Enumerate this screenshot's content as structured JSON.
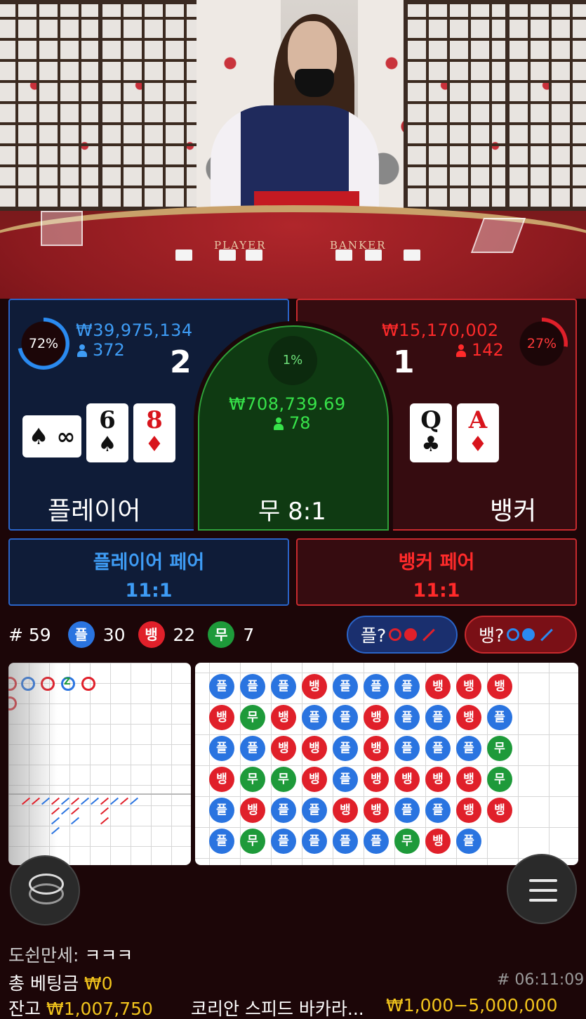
{
  "player": {
    "percent": "72%",
    "percent_value": 0.72,
    "amount": "₩39,975,134",
    "count": "372",
    "score": "2",
    "cards": [
      {
        "rank": "6",
        "suit": "♠",
        "color": "black"
      },
      {
        "rank": "8",
        "suit": "♦",
        "color": "red"
      }
    ],
    "hidden_card": "♠ ∞",
    "label": "플레이어"
  },
  "banker": {
    "percent": "27%",
    "percent_value": 0.27,
    "amount": "₩15,170,002",
    "count": "142",
    "score": "1",
    "cards": [
      {
        "rank": "Q",
        "suit": "♣",
        "color": "black"
      },
      {
        "rank": "A",
        "suit": "♦",
        "color": "red"
      }
    ],
    "label": "뱅커"
  },
  "tie": {
    "percent": "1%",
    "amount": "₩708,739.69",
    "count": "78",
    "label": "무 8:1"
  },
  "pairs": {
    "player": {
      "label": "플레이어 페어",
      "odds": "11:1"
    },
    "banker": {
      "label": "뱅커 페어",
      "odds": "11:1"
    }
  },
  "stats": {
    "round": "# 59",
    "player_short": "플",
    "player_count": "30",
    "banker_short": "뱅",
    "banker_count": "22",
    "tie_short": "무",
    "tie_count": "7"
  },
  "predict": {
    "player_label": "플?",
    "banker_label": "뱅?"
  },
  "table_text": {
    "player": "PLAYER",
    "banker": "BANKER"
  },
  "bead_road": [
    [
      "플",
      "뱅",
      "플",
      "뱅",
      "플",
      "플"
    ],
    [
      "플",
      "무",
      "플",
      "무",
      "뱅",
      "무"
    ],
    [
      "플",
      "뱅",
      "뱅",
      "무",
      "플",
      "플"
    ],
    [
      "뱅",
      "플",
      "뱅",
      "뱅",
      "플",
      "플"
    ],
    [
      "플",
      "플",
      "플",
      "플",
      "뱅",
      "플"
    ],
    [
      "플",
      "뱅",
      "뱅",
      "뱅",
      "뱅",
      "플"
    ],
    [
      "플",
      "플",
      "플",
      "뱅",
      "플",
      "무"
    ],
    [
      "뱅",
      "플",
      "플",
      "뱅",
      "플",
      "뱅"
    ],
    [
      "뱅",
      "뱅",
      "플",
      "뱅",
      "뱅",
      "플"
    ],
    [
      "뱅",
      "플",
      "무",
      "무",
      "뱅",
      ""
    ]
  ],
  "big_road_marker": "Z",
  "chat": {
    "user": "도쉰만세:",
    "message": "ㅋㅋㅋ"
  },
  "footer": {
    "total_bet_label": "총 베팅금",
    "total_bet_value": "₩0",
    "time": "# 06:11:09",
    "balance_label": "잔고",
    "balance_value": "₩1,007,750",
    "table_name": "코리안 스피드 바카라...",
    "limits": "₩1,000−5,000,000"
  },
  "colors": {
    "player": "#2a74e0",
    "banker": "#e0202a",
    "tie": "#1e9a3a",
    "gold": "#f2c41c"
  }
}
